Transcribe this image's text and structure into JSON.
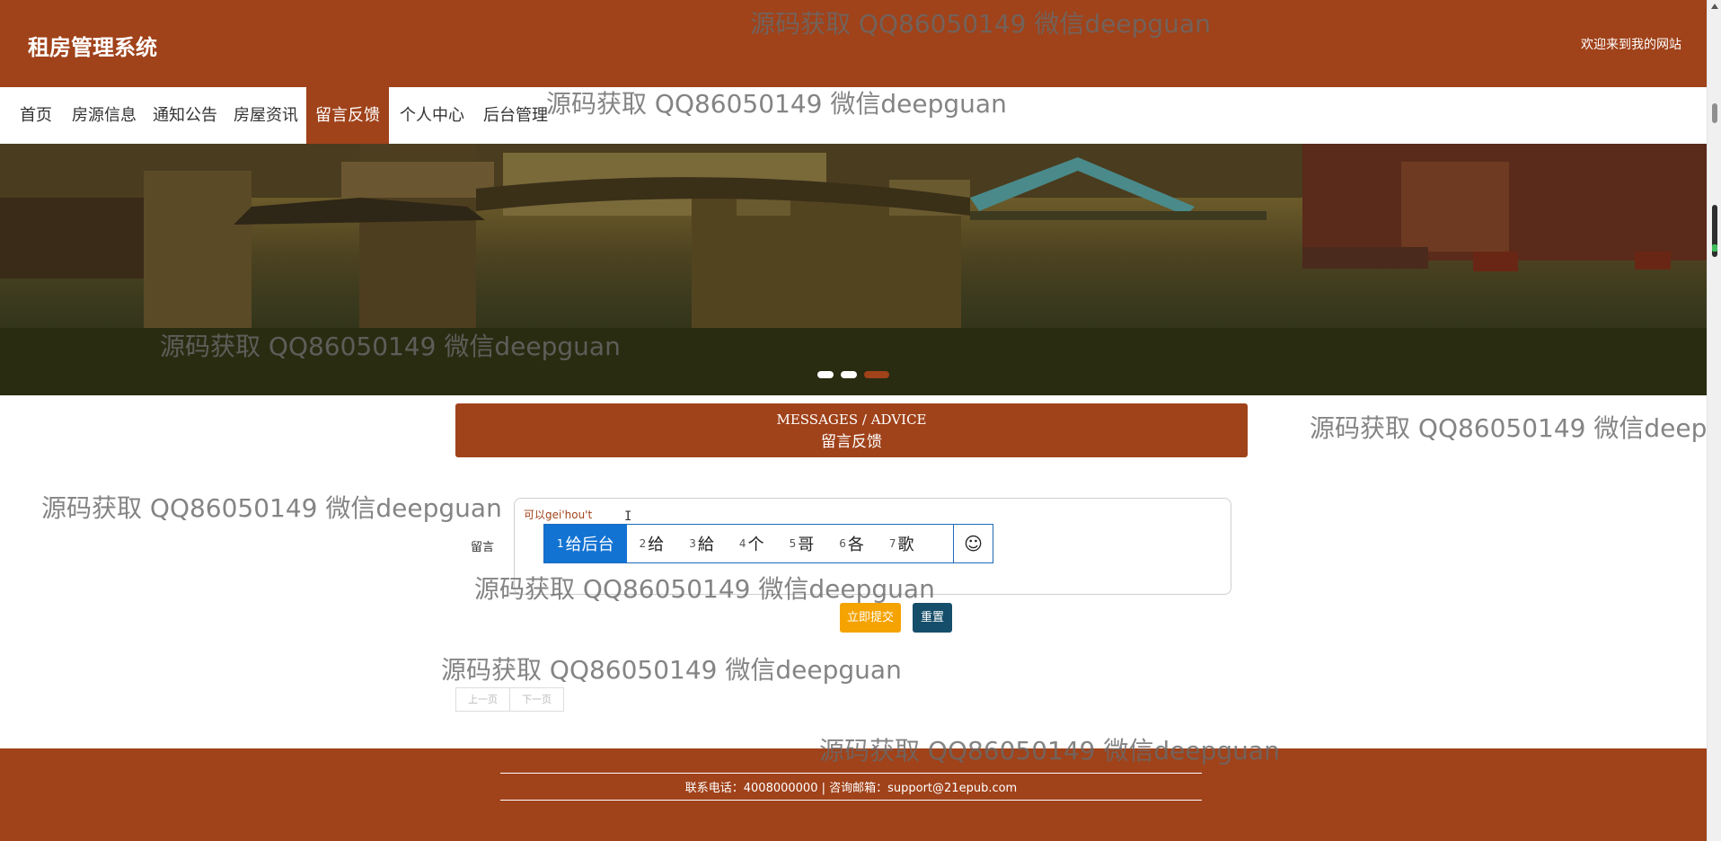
{
  "header": {
    "site_title": "租房管理系统",
    "welcome": "欢迎来到我的网站"
  },
  "nav": {
    "items": [
      {
        "label": "首页"
      },
      {
        "label": "房源信息"
      },
      {
        "label": "通知公告"
      },
      {
        "label": "房屋资讯"
      },
      {
        "label": "留言反馈"
      },
      {
        "label": "个人中心"
      },
      {
        "label": "后台管理"
      }
    ],
    "active_label": "留言反馈"
  },
  "carousel": {
    "slide_count": 3,
    "active_slide": 3
  },
  "section": {
    "title_en": "MESSAGES / ADVICE",
    "title_cn": "留言反馈"
  },
  "form": {
    "label": "留言",
    "input_text": "可以gei'hou't",
    "submit_label": "立即提交",
    "reset_label": "重置"
  },
  "ime": {
    "candidates": [
      {
        "num": "1",
        "text": "给后台"
      },
      {
        "num": "2",
        "text": "给"
      },
      {
        "num": "3",
        "text": "給"
      },
      {
        "num": "4",
        "text": "个"
      },
      {
        "num": "5",
        "text": "哥"
      },
      {
        "num": "6",
        "text": "各"
      },
      {
        "num": "7",
        "text": "歌"
      }
    ],
    "emoji_icon": "smiley-icon"
  },
  "pagination": {
    "prev": "上一页",
    "next": "下一页"
  },
  "footer": {
    "contact": "联系电话：4008000000 | 咨询邮箱：support@21epub.com"
  },
  "watermark": {
    "text": "源码获取 QQ86050149 微信deepguan"
  },
  "colors": {
    "brand": "#a0421a",
    "submit": "#f5a300",
    "reset": "#154e6a",
    "ime_selected": "#1273d3"
  }
}
